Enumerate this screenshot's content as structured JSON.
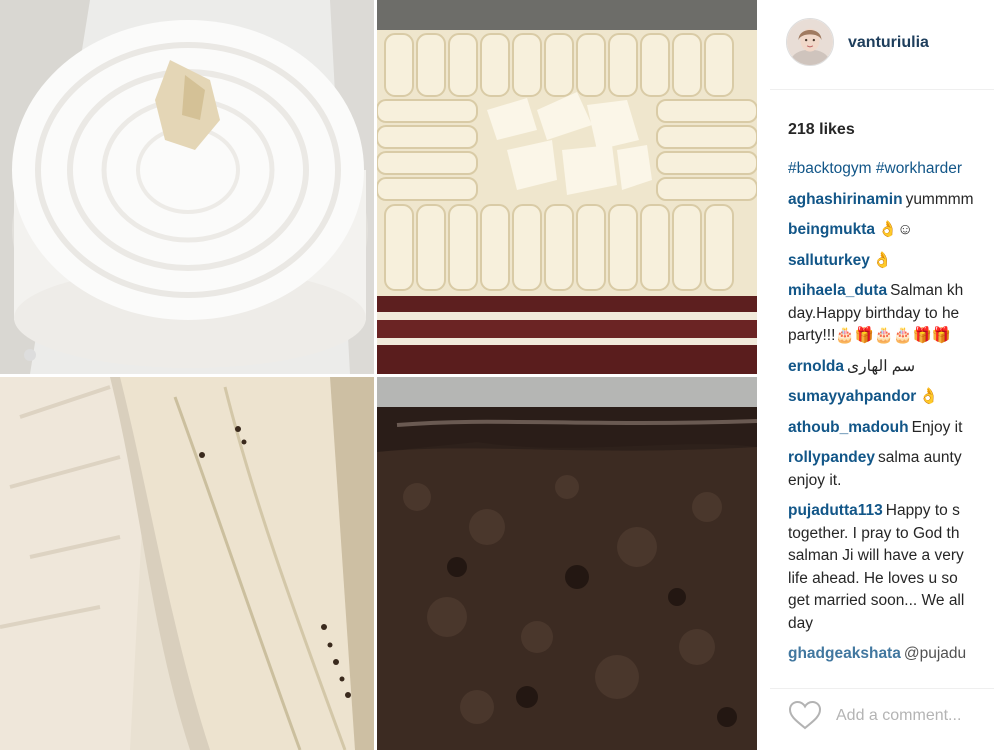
{
  "post": {
    "username": "vanturiulia",
    "likes": "218 likes",
    "hashtags": "#backtogym #workharder",
    "comments": [
      {
        "user": "aghashirinamin",
        "lines": [
          "yummmm"
        ]
      },
      {
        "user": "beingmukta",
        "lines": [
          "👌☺"
        ]
      },
      {
        "user": "salluturkey",
        "lines": [
          "👌"
        ]
      },
      {
        "user": "mihaela_duta",
        "lines": [
          "Salman kh",
          "day.Happy birthday to he",
          "party!!!🎂🎁🎂🎂🎁🎁"
        ]
      },
      {
        "user": "ernolda",
        "lines": [
          "سم الهاری"
        ]
      },
      {
        "user": "sumayyahpandor",
        "lines": [
          "👌"
        ]
      },
      {
        "user": "athoub_madouh",
        "lines": [
          "Enjoy it"
        ]
      },
      {
        "user": "rollypandey",
        "lines": [
          "salma aunty",
          "enjoy it."
        ]
      },
      {
        "user": "pujadutta113",
        "lines": [
          "Happy to s",
          "together. I pray to God th",
          "salman Ji will have a very",
          "life ahead. He loves u so",
          "get married soon... We all",
          "day"
        ]
      },
      {
        "user": "ghadgeakshata",
        "lines": [
          "@pujadu"
        ]
      }
    ],
    "add_comment_placeholder": "Add a comment...",
    "icons": {
      "like": "heart-outline-icon",
      "avatar": "profile-photo"
    }
  },
  "photos": [
    {
      "name": "white-frosted-cake",
      "color": "#f4f2ee"
    },
    {
      "name": "white-chocolate-red-velvet-cake",
      "color": "#efe6cf"
    },
    {
      "name": "banana-cake-closeup",
      "color": "#e8dfcf"
    },
    {
      "name": "chocolate-cake-slice",
      "color": "#3a2a22"
    }
  ]
}
